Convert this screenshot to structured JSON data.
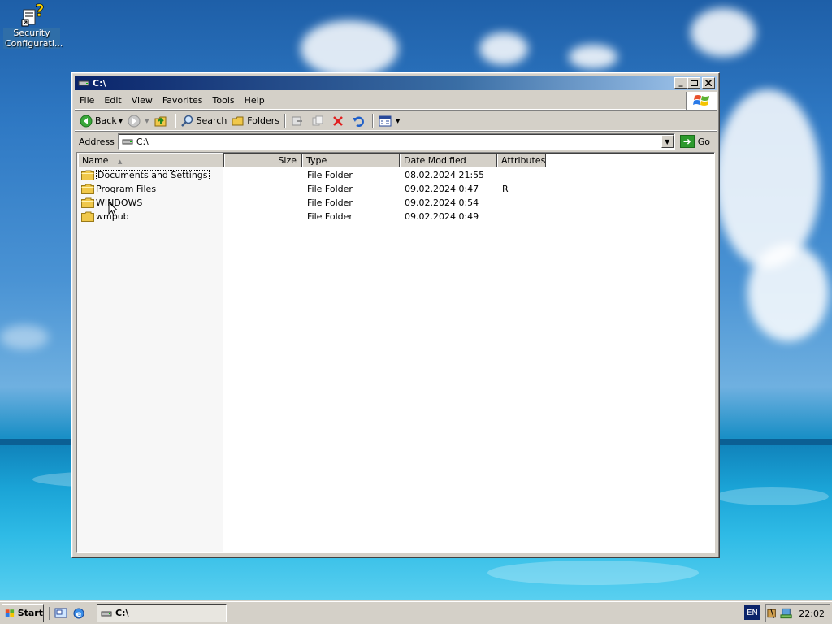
{
  "desktop": {
    "icons": [
      {
        "label": "Security Configurati...",
        "icon": "security-config-help-icon"
      }
    ]
  },
  "window": {
    "title": "C:\\",
    "title_icon": "drive-icon",
    "controls": {
      "minimize": "minimize-icon",
      "maximize": "maximize-icon",
      "close": "close-icon"
    },
    "menu": [
      "File",
      "Edit",
      "View",
      "Favorites",
      "Tools",
      "Help"
    ],
    "toolbar": {
      "back_label": "Back",
      "search_label": "Search",
      "folders_label": "Folders"
    },
    "address": {
      "label": "Address",
      "value": "C:\\",
      "go_label": "Go"
    },
    "list": {
      "columns": [
        "Name",
        "Size",
        "Type",
        "Date Modified",
        "Attributes"
      ],
      "rows": [
        {
          "name": "Documents and Settings",
          "size": "",
          "type": "File Folder",
          "date": "08.02.2024 21:55",
          "attributes": ""
        },
        {
          "name": "Program Files",
          "size": "",
          "type": "File Folder",
          "date": "09.02.2024 0:47",
          "attributes": "R"
        },
        {
          "name": "WINDOWS",
          "size": "",
          "type": "File Folder",
          "date": "09.02.2024 0:54",
          "attributes": ""
        },
        {
          "name": "wmpub",
          "size": "",
          "type": "File Folder",
          "date": "09.02.2024 0:49",
          "attributes": ""
        }
      ]
    }
  },
  "taskbar": {
    "start_label": "Start",
    "task_label": "C:\\",
    "language": "EN",
    "clock": "22:02"
  },
  "colors": {
    "title_active": "#0a246a",
    "face": "#d4d0c8",
    "folder": "#f0c84a"
  }
}
